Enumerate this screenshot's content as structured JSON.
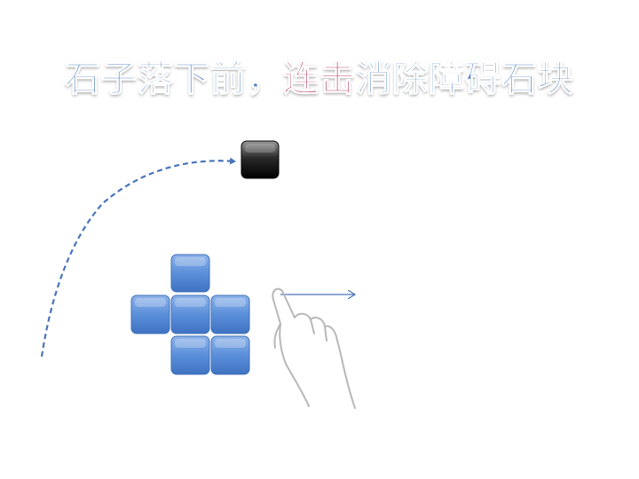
{
  "title": {
    "part1": "石子落下前，",
    "part2": "连击",
    "part3": "消除障碍石块"
  },
  "colors": {
    "title_blue": "#4f7fc4",
    "title_red": "#b0305a",
    "block_blue": "#5b8fd9",
    "stone_black": "#111111",
    "path_blue": "#4a74b8"
  },
  "icons": {
    "falling_stone": "black-square-stone",
    "obstacle_blocks": "blue-block",
    "gesture": "swipe-hand-icon"
  }
}
